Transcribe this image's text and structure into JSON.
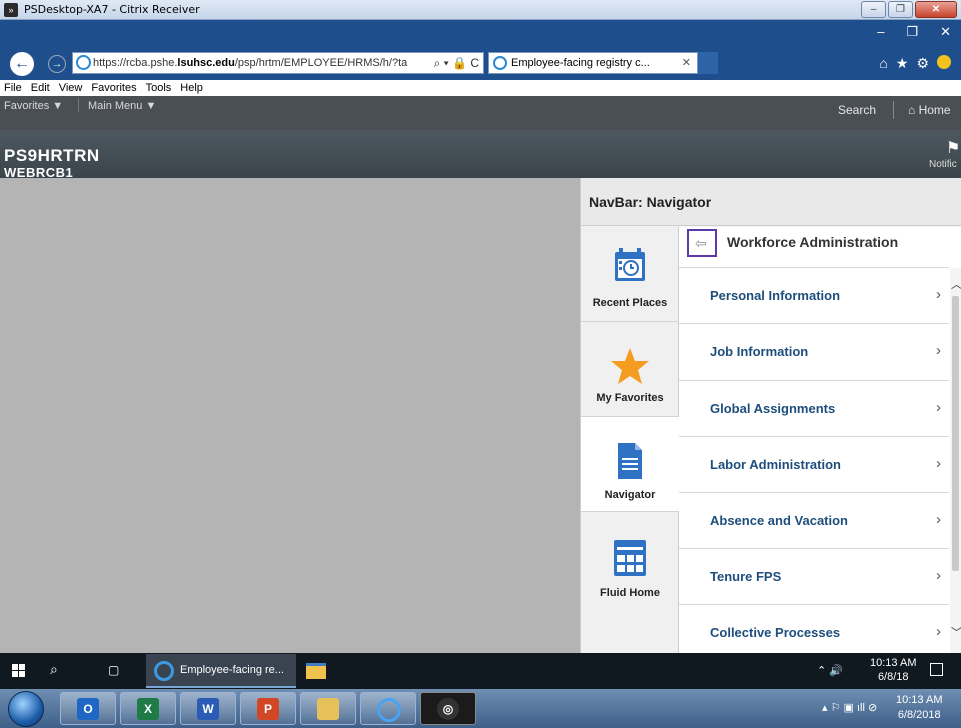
{
  "citrix": {
    "title": "PSDesktop-XA7 - Citrix Receiver",
    "icon": "citrix-icon"
  },
  "browser": {
    "url_prefix": "https://rcba.pshe.",
    "url_host": "lsuhsc.edu",
    "url_rest": "/psp/hrtm/EMPLOYEE/HRMS/h/?ta",
    "url_tools": "⌕ ▾ 🔒 C",
    "tab_title": "Employee-facing registry c...",
    "menu": [
      "File",
      "Edit",
      "View",
      "Favorites",
      "Tools",
      "Help"
    ]
  },
  "ps_header": {
    "favorites": "Favorites ▼",
    "main_menu": "Main Menu ▼",
    "search": "Search",
    "home": "⌂ Home",
    "system": "PS9HRTRN",
    "user": "WEBRCB1",
    "notifications": "Notific"
  },
  "navbar": {
    "title": "NavBar: Navigator",
    "side_items": [
      {
        "label": "Recent Places",
        "icon": "calendar-clock-icon"
      },
      {
        "label": "My Favorites",
        "icon": "star-icon"
      },
      {
        "label": "Navigator",
        "icon": "document-icon"
      },
      {
        "label": "Fluid Home",
        "icon": "dashboard-icon"
      }
    ],
    "section_title": "Workforce Administration",
    "items": [
      "Personal Information",
      "Job Information",
      "Global Assignments",
      "Labor Administration",
      "Absence and Vacation",
      "Tenure FPS",
      "Collective Processes"
    ]
  },
  "taskbar_remote": {
    "ie_task": "Employee-facing re...",
    "time": "10:13 AM",
    "date": "6/8/18"
  },
  "taskbar_local": {
    "apps": [
      "outlook",
      "excel",
      "word",
      "powerpoint",
      "file-explorer",
      "internet-explorer",
      "citrix"
    ],
    "time": "10:13 AM",
    "date": "6/8/2018"
  },
  "colors": {
    "ie_chrome": "#1f4e8c",
    "ps_header": "#4a4f55",
    "link_blue": "#1e4e7c",
    "back_focus": "#5d3aa8",
    "star": "#f39c1f",
    "nav_blue": "#2f72c4"
  }
}
